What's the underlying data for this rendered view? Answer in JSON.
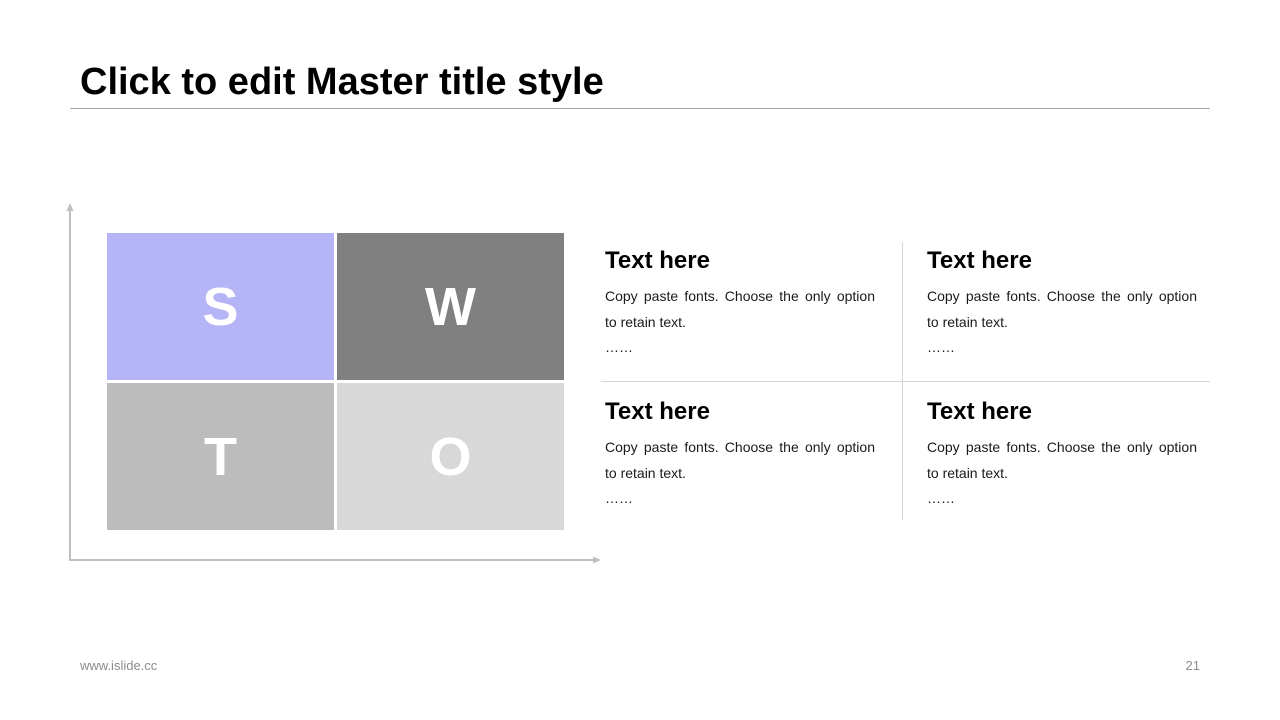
{
  "title": "Click to edit Master title style",
  "swot": {
    "s": {
      "letter": "S",
      "color": "#b4b4f6"
    },
    "w": {
      "letter": "W",
      "color": "#808080"
    },
    "t": {
      "letter": "T",
      "color": "#bcbcbc"
    },
    "o": {
      "letter": "O",
      "color": "#d8d8d8"
    }
  },
  "cells": [
    {
      "heading": "Text here",
      "body": "Copy paste fonts. Choose the only option to retain text.",
      "ellipsis": "……"
    },
    {
      "heading": "Text here",
      "body": "Copy paste fonts. Choose the only option to retain text.",
      "ellipsis": "……"
    },
    {
      "heading": "Text here",
      "body": "Copy paste fonts. Choose the only option to retain text.",
      "ellipsis": "……"
    },
    {
      "heading": "Text here",
      "body": "Copy paste fonts. Choose the only option to retain text.",
      "ellipsis": "……"
    }
  ],
  "footer": {
    "url": "www.islide.cc",
    "page": "21"
  }
}
